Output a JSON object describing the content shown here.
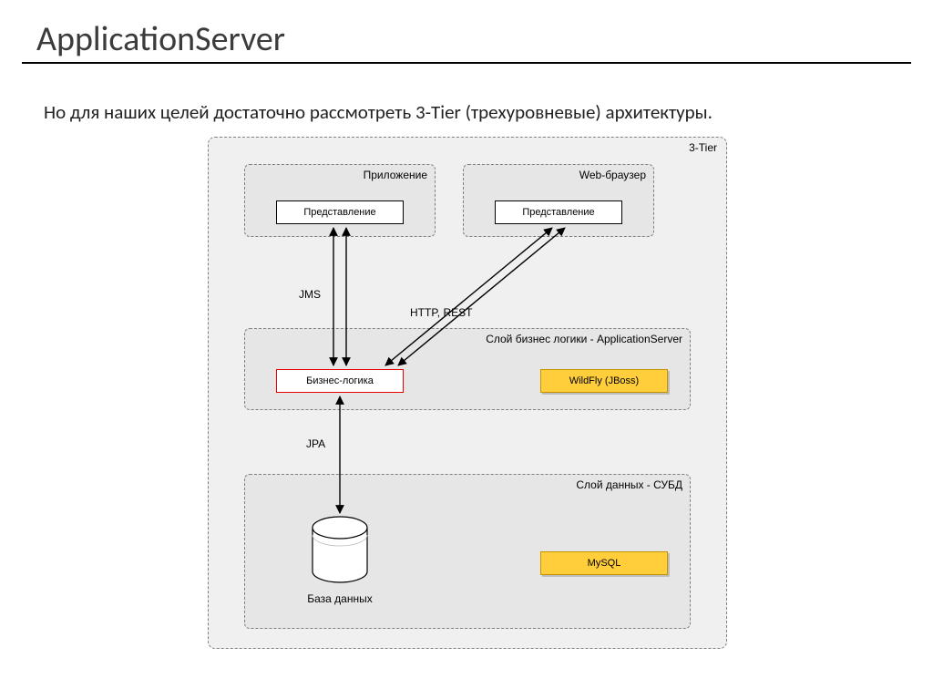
{
  "title": "ApplicationServer",
  "body_text": "Но для наших целей достаточно рассмотреть 3-Tier (трехуровневые) архитектуры.",
  "outer": {
    "label": "3-Tier"
  },
  "top": {
    "app": {
      "label": "Приложение",
      "inner": "Представление"
    },
    "web": {
      "label": "Web-браузер",
      "inner": "Представление"
    }
  },
  "connections": {
    "jms": "JMS",
    "http": "HTTP, REST",
    "jpa": "JPA"
  },
  "mid": {
    "label": "Слой бизнес логики - ApplicationServer",
    "logic": "Бизнес-логика",
    "server": "WildFly (JBoss)"
  },
  "bot": {
    "label": "Слой данных - СУБД",
    "db_caption": "База данных",
    "db_tech": "MySQL"
  }
}
